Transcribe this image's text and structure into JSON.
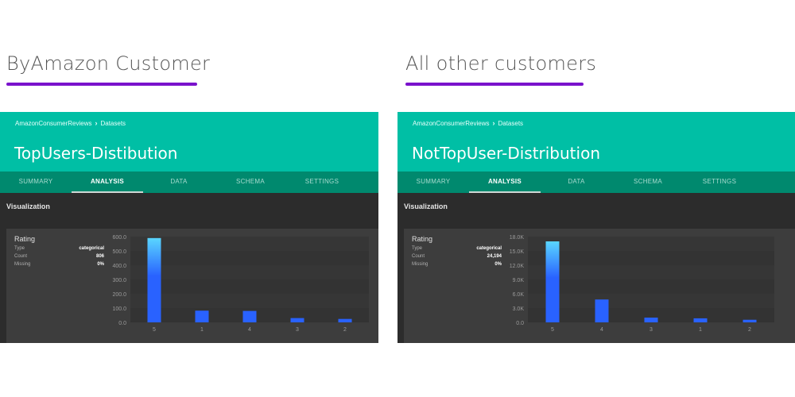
{
  "captions": {
    "left": "ByAmazon Customer",
    "right": "All other customers"
  },
  "colors": {
    "header": "#00bfa5",
    "tabs_bar": "#00896e",
    "underline": "#7a12cc",
    "bar_top": "#5ad6ff",
    "bar_main": "#2962ff",
    "background_dark": "#2c2c2c",
    "card": "#3d3d3d"
  },
  "panels": [
    {
      "breadcrumb": [
        "AmazonConsumerReviews",
        "Datasets"
      ],
      "breadcrumb_sep_icon": "chevron-right-icon",
      "title": "TopUsers-Distibution",
      "tabs": [
        {
          "label": "SUMMARY",
          "active": false
        },
        {
          "label": "ANALYSIS",
          "active": true
        },
        {
          "label": "DATA",
          "active": false
        },
        {
          "label": "SCHEMA",
          "active": false
        },
        {
          "label": "SETTINGS",
          "active": false
        }
      ],
      "section_title": "Visualization",
      "field": {
        "name": "Rating",
        "stats": [
          {
            "label": "Type",
            "value": "categorical"
          },
          {
            "label": "Count",
            "value": "806"
          },
          {
            "label": "Missing",
            "value": "0%"
          }
        ]
      }
    },
    {
      "breadcrumb": [
        "AmazonConsumerReviews",
        "Datasets"
      ],
      "breadcrumb_sep_icon": "chevron-right-icon",
      "title": "NotTopUser-Distribution",
      "tabs": [
        {
          "label": "SUMMARY",
          "active": false
        },
        {
          "label": "ANALYSIS",
          "active": true
        },
        {
          "label": "DATA",
          "active": false
        },
        {
          "label": "SCHEMA",
          "active": false
        },
        {
          "label": "SETTINGS",
          "active": false
        }
      ],
      "section_title": "Visualization",
      "field": {
        "name": "Rating",
        "stats": [
          {
            "label": "Type",
            "value": "categorical"
          },
          {
            "label": "Count",
            "value": "24,194"
          },
          {
            "label": "Missing",
            "value": "0%"
          }
        ]
      }
    }
  ],
  "chart_data": [
    {
      "type": "bar",
      "title": "Rating",
      "categories": [
        "5",
        "1",
        "4",
        "3",
        "2"
      ],
      "values": [
        590,
        82,
        80,
        30,
        24
      ],
      "ylim": [
        0,
        600
      ],
      "yticks": [
        0,
        100,
        200,
        300,
        400,
        500,
        600
      ],
      "ytick_labels": [
        "0.0",
        "100.0",
        "200.0",
        "300.0",
        "400.0",
        "500.0",
        "600.0"
      ],
      "xlabel": "",
      "ylabel": "",
      "grid": true
    },
    {
      "type": "bar",
      "title": "Rating",
      "categories": [
        "5",
        "4",
        "3",
        "1",
        "2"
      ],
      "values": [
        17000,
        4800,
        1000,
        850,
        544
      ],
      "ylim": [
        0,
        18000
      ],
      "yticks": [
        0,
        3000,
        6000,
        9000,
        12000,
        15000,
        18000
      ],
      "ytick_labels": [
        "0.0",
        "3.0K",
        "6.0K",
        "9.0K",
        "12.0K",
        "15.0K",
        "18.0K"
      ],
      "xlabel": "",
      "ylabel": "",
      "grid": true
    }
  ]
}
